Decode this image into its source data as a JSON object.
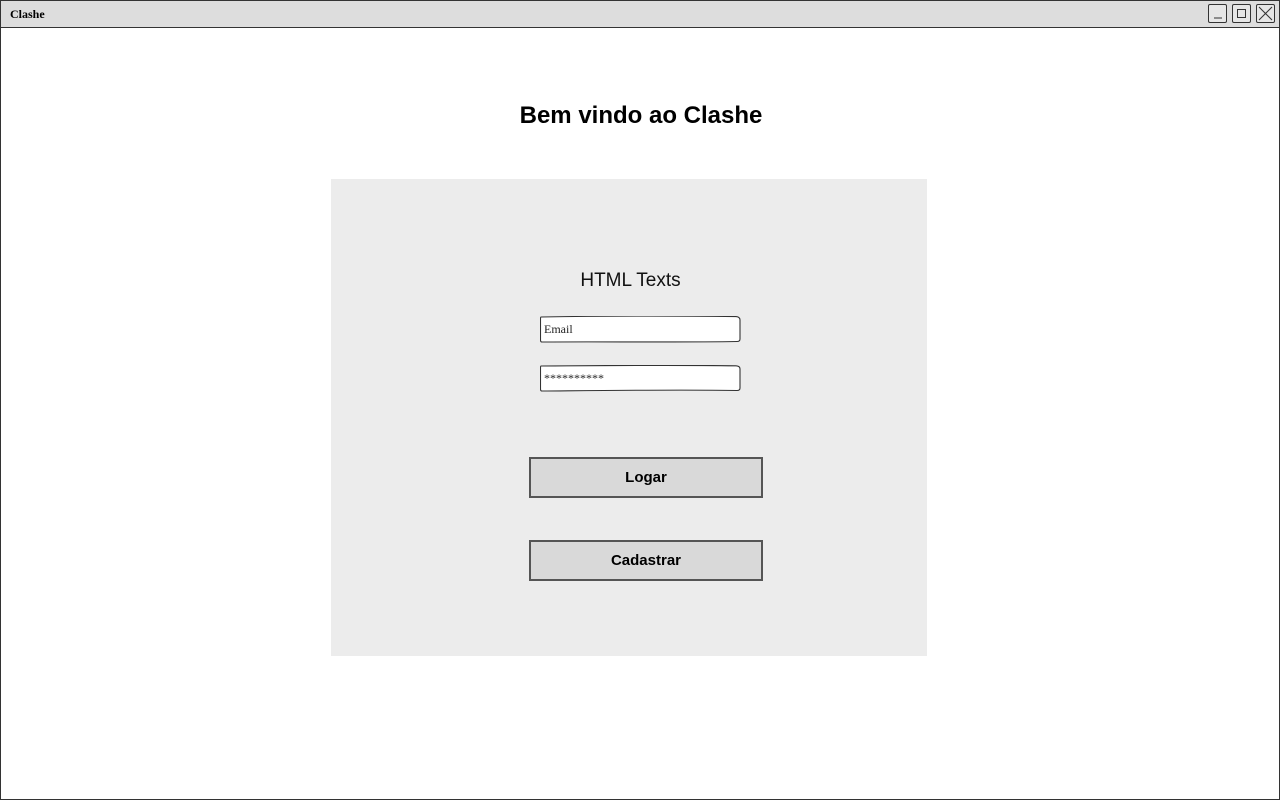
{
  "window": {
    "title": "Clashe",
    "controls": {
      "minimize_icon": "minimize-icon",
      "maximize_icon": "maximize-icon",
      "close_icon": "close-icon"
    }
  },
  "main": {
    "heading": "Bem vindo ao Clashe",
    "panel": {
      "label": "HTML Texts",
      "email": {
        "placeholder": "Email",
        "value": ""
      },
      "password": {
        "value": "**********"
      },
      "login_label": "Logar",
      "register_label": "Cadastrar"
    }
  },
  "colors": {
    "titlebar": "#dddddd",
    "panel": "#ececec",
    "button": "#d9d9d9",
    "border": "#333333"
  }
}
